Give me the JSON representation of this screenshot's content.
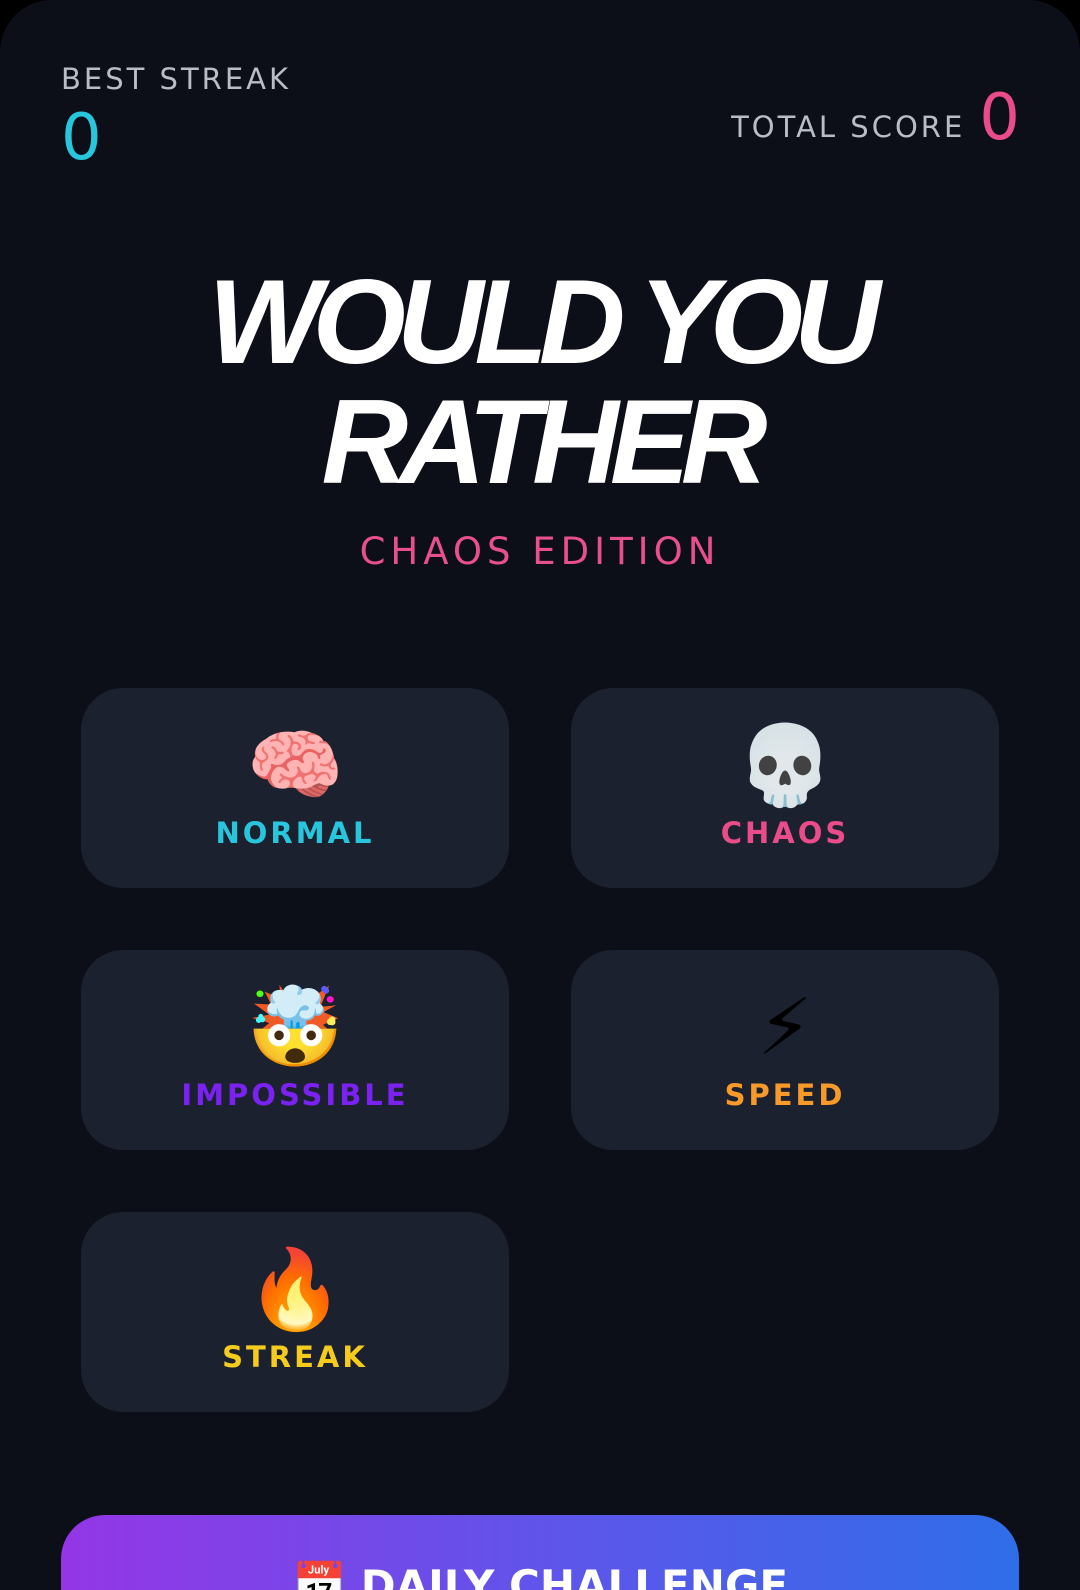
{
  "stats": {
    "best_streak_label": "BEST STREAK",
    "best_streak_value": "0",
    "total_score_label": "TOTAL SCORE",
    "total_score_value": "0"
  },
  "header": {
    "title_line1": "WOULD YOU",
    "title_line2": "RATHER",
    "subtitle": "CHAOS EDITION"
  },
  "modes": [
    {
      "label": "NORMAL",
      "icon": "🧠",
      "icon_name": "brain-icon",
      "color": "#27c6dd"
    },
    {
      "label": "CHAOS",
      "icon": "💀",
      "icon_name": "skull-icon",
      "color": "#ea4c89"
    },
    {
      "label": "IMPOSSIBLE",
      "icon": "🤯",
      "icon_name": "exploding-head-icon",
      "color": "#7b22f2"
    },
    {
      "label": "SPEED",
      "icon": "⚡",
      "icon_name": "lightning-icon",
      "color": "#f79a2a"
    },
    {
      "label": "STREAK",
      "icon": "🔥",
      "icon_name": "fire-icon",
      "color": "#f5cc1e"
    }
  ],
  "daily": {
    "icon": "📅",
    "icon_name": "calendar-icon",
    "label": "DAILY CHALLENGE"
  },
  "colors": {
    "background": "#0c0f17",
    "card": "#1c2130",
    "accent_cyan": "#27c6dd",
    "accent_pink": "#ea4c89"
  }
}
